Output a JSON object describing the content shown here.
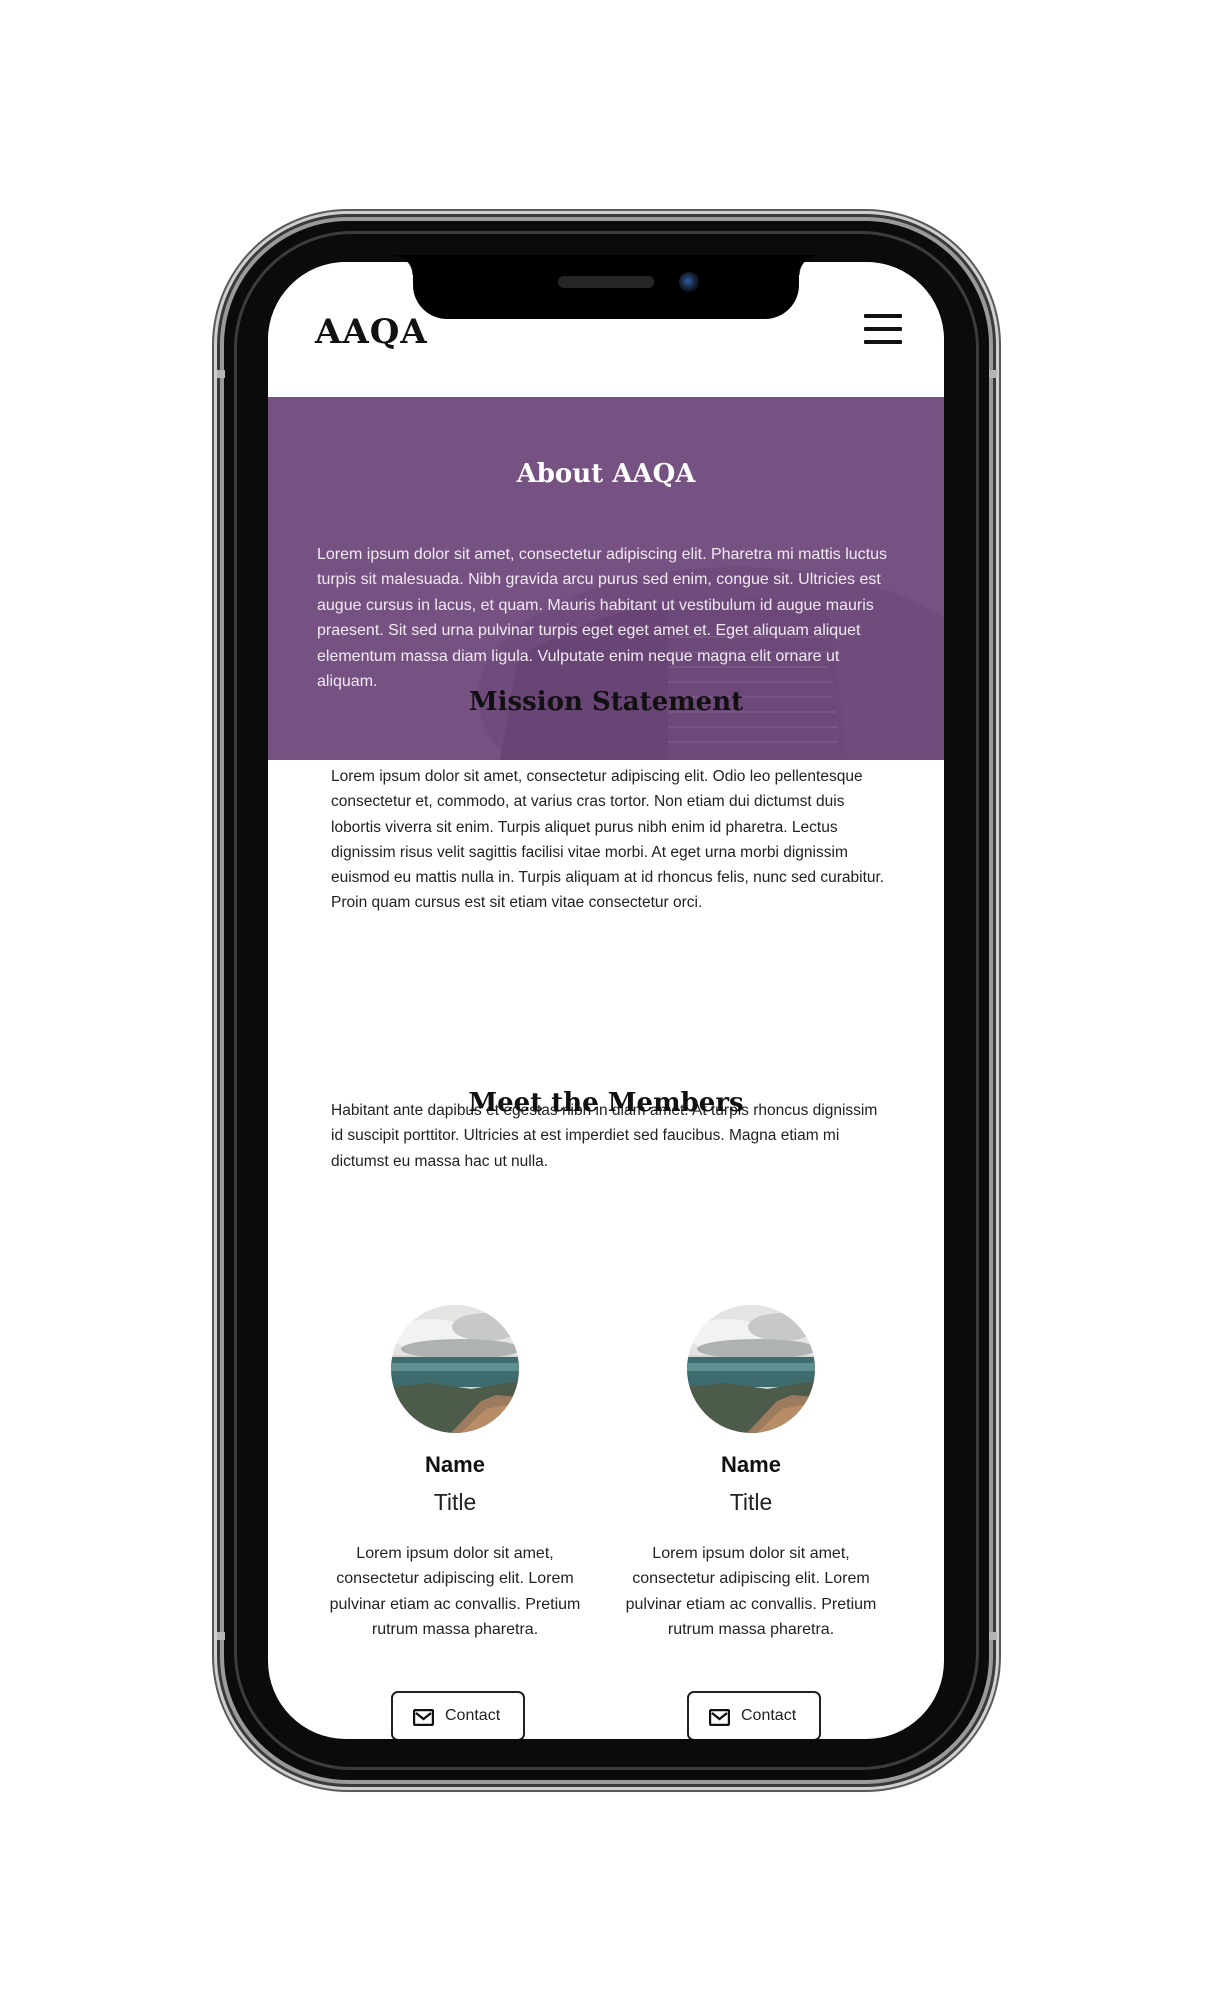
{
  "brand": {
    "logo": "AAQA",
    "accent": "#765282"
  },
  "header": {
    "menu_icon": "hamburger-menu-icon"
  },
  "hero": {
    "title": "About AAQA",
    "text": "Lorem ipsum dolor sit amet, consectetur adipiscing elit. Pharetra mi mattis luctus turpis sit malesuada. Nibh gravida arcu purus sed enim, congue sit. Ultricies est augue cursus in lacus, et quam. Mauris habitant ut vestibulum id augue mauris praesent. Sit sed urna pulvinar turpis eget eget amet et. Eget aliquam aliquet elementum massa diam ligula. Vulputate enim neque magna elit ornare ut aliquam."
  },
  "mission": {
    "title": "Mission Statement",
    "paragraph_1": "Lorem ipsum dolor sit amet, consectetur adipiscing elit. Odio leo pellentesque consectetur et, commodo, at varius cras tortor. Non etiam dui dictumst duis lobortis viverra sit enim. Turpis aliquet purus nibh enim id pharetra. Lectus dignissim risus velit sagittis facilisi vitae morbi. At eget urna morbi dignissim euismod eu mattis nulla in. Turpis aliquam at id rhoncus felis, nunc sed curabitur. Proin quam cursus est sit etiam vitae consectetur orci.",
    "paragraph_2": "Habitant ante dapibus et egestas nibh in diam amet. At turpis rhoncus dignissim id suscipit porttitor. Ultricies at est imperdiet sed faucibus. Magna etiam mi dictumst eu massa hac ut nulla."
  },
  "members": {
    "title": "Meet the Members",
    "items": [
      {
        "name": "Name",
        "title": "Title",
        "description": "Lorem ipsum dolor sit amet, consectetur adipiscing elit. Lorem pulvinar etiam ac convallis. Pretium rutrum massa pharetra.",
        "contact_label": "Contact"
      },
      {
        "name": "Name",
        "title": "Title",
        "description": "Lorem ipsum dolor sit amet, consectetur adipiscing elit. Lorem pulvinar etiam ac convallis. Pretium rutrum massa pharetra.",
        "contact_label": "Contact"
      }
    ]
  }
}
